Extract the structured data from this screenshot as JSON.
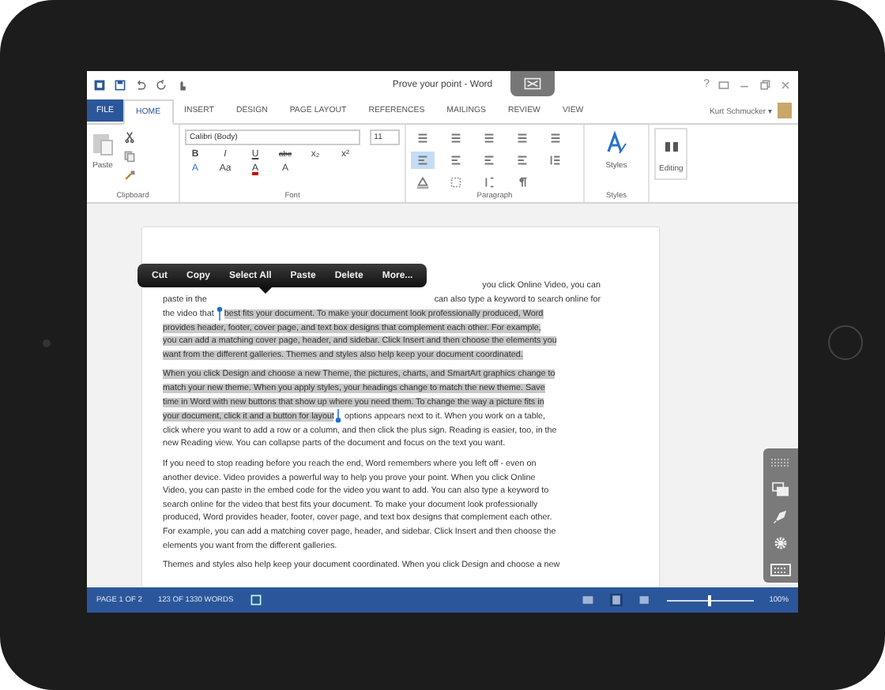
{
  "window": {
    "title": "Prove your point - Word",
    "help": "?"
  },
  "tabs": [
    {
      "label": "FILE",
      "kind": "file",
      "selected": false
    },
    {
      "label": "HOME",
      "kind": "tab",
      "selected": true
    },
    {
      "label": "INSERT",
      "kind": "tab",
      "selected": false
    },
    {
      "label": "DESIGN",
      "kind": "tab",
      "selected": false
    },
    {
      "label": "PAGE LAYOUT",
      "kind": "tab",
      "selected": false
    },
    {
      "label": "REFERENCES",
      "kind": "tab",
      "selected": false
    },
    {
      "label": "MAILINGS",
      "kind": "tab",
      "selected": false
    },
    {
      "label": "REVIEW",
      "kind": "tab",
      "selected": false
    },
    {
      "label": "VIEW",
      "kind": "tab",
      "selected": false
    }
  ],
  "user": "Kurt Schmucker ▾",
  "ribbon": {
    "paste": "Paste",
    "font_name": "Calibri (Body)",
    "font_size": "11",
    "font_buttons": [
      "B",
      "I",
      "U",
      "abc",
      "x₂",
      "x²"
    ],
    "font_buttons_2": [
      "A",
      "Aa",
      "A",
      "A"
    ],
    "align_buttons": [
      {
        "selected": true
      },
      {
        "selected": false
      },
      {
        "selected": false
      },
      {
        "selected": false
      }
    ],
    "styles": "Styles",
    "editing": "Editing",
    "groups": [
      "Clipboard",
      "Font",
      "Paragraph",
      "Styles"
    ]
  },
  "context_menu": [
    "Cut",
    "Copy",
    "Select All",
    "Paste",
    "Delete",
    "More..."
  ],
  "document": {
    "partial_lines": [
      {
        "right": "you click Online Video, you can"
      },
      {
        "left": "paste in the",
        "right": "can also type a keyword to search online for"
      }
    ],
    "paragraphs": [
      [
        [
          {
            "text": "the video that ",
            "selected": false
          },
          {
            "text": "best fits your document. To make your document look professionally produced, Word",
            "selected": true
          }
        ],
        [
          {
            "text": "provides header, footer, cover page, and text box designs that complement each other. For example,",
            "selected": true
          }
        ],
        [
          {
            "text": "you can add a matching cover page, header, and sidebar. Click Insert and then choose the elements you",
            "selected": true
          }
        ],
        [
          {
            "text": "want from the different galleries. Themes and styles also help keep your document coordinated.",
            "selected": true
          }
        ]
      ],
      [
        [
          {
            "text": "When you click Design and choose a new Theme, the pictures, charts, and SmartArt graphics change to",
            "selected": true
          }
        ],
        [
          {
            "text": "match your new theme. When you apply styles, your headings change to match the new theme. Save",
            "selected": true
          }
        ],
        [
          {
            "text": "time in Word with new buttons that show up where you need them. To change the way a picture fits in",
            "selected": true
          }
        ],
        [
          {
            "text": "your document, click it and a button for layout",
            "selected": true
          },
          {
            "text": " options appears next to it. When you work on a table,",
            "selected": false
          }
        ],
        [
          {
            "text": "click where you want to add a row or a column, and then click the plus sign. Reading is easier, too, in the",
            "selected": false
          }
        ],
        [
          {
            "text": "new Reading view. You can collapse parts of the document and focus on the text you want.",
            "selected": false
          }
        ]
      ],
      [
        [
          {
            "text": "If you need to stop reading before you reach the end, Word remembers where you left off - even on",
            "selected": false
          }
        ],
        [
          {
            "text": "another device. Video provides a powerful way to help you prove your point. When you click Online",
            "selected": false
          }
        ],
        [
          {
            "text": "Video, you can paste in the embed code for the video you want to add. You can also type a keyword to",
            "selected": false
          }
        ],
        [
          {
            "text": "search online for the video that best fits your document. To make your document look professionally",
            "selected": false
          }
        ],
        [
          {
            "text": "produced, Word provides header, footer, cover page, and text box designs that complement each other.",
            "selected": false
          }
        ],
        [
          {
            "text": "For example, you can add a matching cover page, header, and sidebar. Click Insert and then choose the",
            "selected": false
          }
        ],
        [
          {
            "text": "elements you want from the different galleries.",
            "selected": false
          }
        ]
      ],
      [
        [
          {
            "text": "Themes and styles also help keep your document coordinated. When you click Design and choose a new",
            "selected": false
          }
        ]
      ]
    ]
  },
  "status_bar": {
    "page": "PAGE 1 OF 2",
    "words": "123 OF 1330 WORDS",
    "zoom": "100%",
    "level": 0.5
  }
}
